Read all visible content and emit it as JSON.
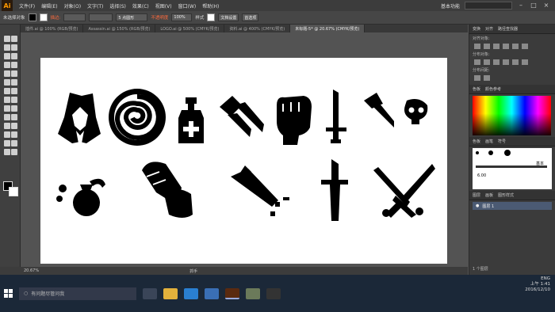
{
  "app": {
    "logo": "Ai",
    "badge": "未选择对象"
  },
  "menu": [
    "文件(F)",
    "编辑(E)",
    "对象(O)",
    "文字(T)",
    "选择(S)",
    "效果(C)",
    "视图(V)",
    "窗口(W)",
    "帮助(H)"
  ],
  "workspace": "基本功能",
  "control": {
    "stroke_label": "描边:",
    "points": "5 点圆形",
    "opacity_label": "不透明度",
    "opacity_value": "100%",
    "style_label": "样式",
    "doc_setup": "文档设置",
    "prefs": "首选项"
  },
  "tabs": [
    {
      "label": "插件.ai @ 100% (RGB/预览)",
      "active": false
    },
    {
      "label": "Assassin.ai @ 150% (RGB/预览)",
      "active": false
    },
    {
      "label": "LOGO.ai @ 500% (CMYK/预览)",
      "active": false
    },
    {
      "label": "资料.ai @ 400% (CMYK/预览)",
      "active": false
    },
    {
      "label": "未标题-5* @ 20.67% (CMYK/预览)",
      "active": true
    }
  ],
  "right_panel": {
    "align_tabs": [
      "变换",
      "对齐",
      "路径查找器"
    ],
    "align_label": "对齐对象:",
    "distribute_label": "分布对象:",
    "spacing_label": "分布间距:",
    "color_tabs": [
      "色板",
      "颜色参考"
    ],
    "brush_tabs": [
      "色板",
      "画笔",
      "符号"
    ],
    "brush_size": "6.00",
    "basic_label": "基本",
    "layer_tabs": [
      "图层",
      "画板",
      "图形样式"
    ],
    "layer_name": "图层 1",
    "layer_count": "1 个图层"
  },
  "status": {
    "zoom": "20.67%",
    "tool": "抓手"
  },
  "taskbar": {
    "search_placeholder": "有问题尽管问我",
    "time": "上午 1:41",
    "date": "2016/12/10",
    "ime": "ENG"
  }
}
